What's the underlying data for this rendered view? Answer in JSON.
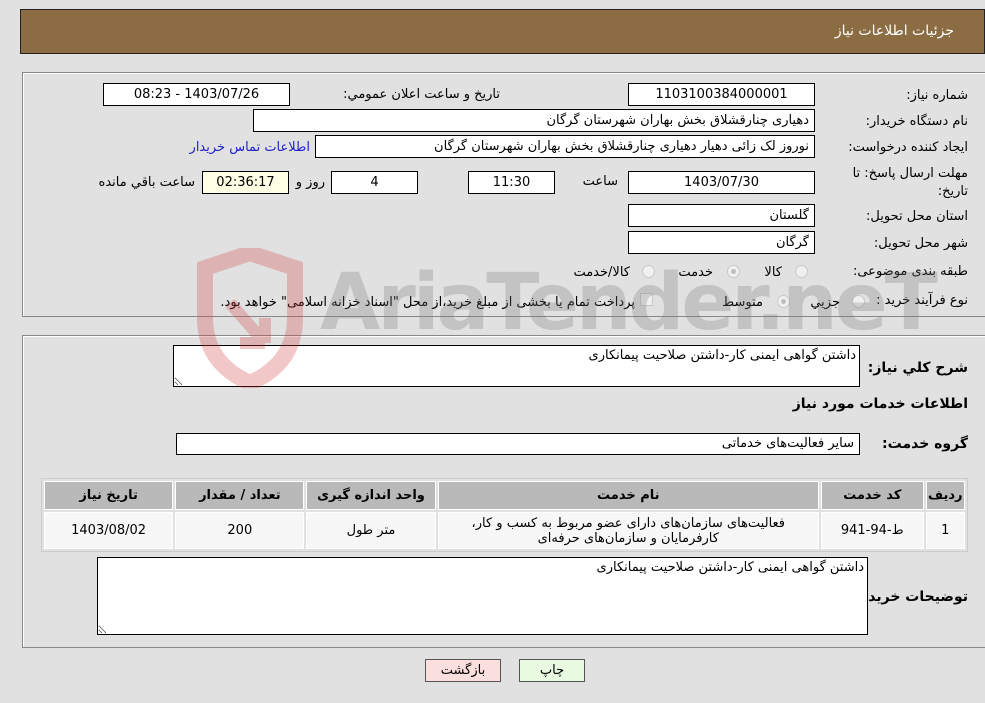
{
  "header": {
    "title": "جزئیات اطلاعات نیاز"
  },
  "form": {
    "need_number": {
      "label": "شماره نیاز:",
      "value": "1103100384000001"
    },
    "announce_datetime": {
      "label": "تاریخ و ساعت اعلان عمومي:",
      "value": "1403/07/26 - 08:23"
    },
    "buyer_org": {
      "label": "نام دستگاه خریدار:",
      "value": "دهیاری چنارقشلاق بخش بهاران شهرستان گرگان"
    },
    "requester": {
      "label": "ایجاد کننده درخواست:",
      "value": "نوروز لک زائی دهیار دهیاری چنارقشلاق بخش بهاران شهرستان گرگان"
    },
    "buyer_contact_link": "اطلاعات تماس خریدار",
    "deadline": {
      "label": "مهلت ارسال پاسخ: تا تاریخ:",
      "date": "1403/07/30",
      "time_label": "ساعت",
      "time": "11:30",
      "days": "4",
      "days_label": "روز و",
      "remaining": "02:36:17",
      "remaining_label": "ساعت باقي مانده"
    },
    "province": {
      "label": "استان محل تحویل:",
      "value": "گلستان"
    },
    "city": {
      "label": "شهر محل تحویل:",
      "value": "گرگان"
    },
    "category": {
      "label": "طبقه بندی موضوعی:",
      "options": [
        "کالا",
        "خدمت",
        "کالا/خدمت"
      ],
      "selected": "خدمت"
    },
    "purchase_type": {
      "label": "نوع فرآیند خرید :",
      "options": [
        "جزيي",
        "متوسط"
      ],
      "selected": "متوسط",
      "treasury_note": "پرداخت تمام یا بخشی از مبلغ خرید،از محل \"اسناد خزانه اسلامی\" خواهد بود.",
      "treasury_checked": false
    }
  },
  "details": {
    "summary_label": "شرح کلي نیاز:",
    "summary_value": "داشتن گواهی ایمنی کار-داشتن صلاحیت پیمانکاری",
    "services_heading": "اطلاعات خدمات مورد نیاز",
    "service_group_label": "گروه خدمت:",
    "service_group_value": "سایر فعالیت‌های خدماتی",
    "table": {
      "headers": [
        "ردیف",
        "کد خدمت",
        "نام خدمت",
        "واحد اندازه گیری",
        "تعداد / مقدار",
        "تاریخ نیاز"
      ],
      "rows": [
        {
          "row": "1",
          "code": "ط-94-941",
          "name": "فعالیت‌های سازمان‌های دارای عضو مربوط به کسب و کار، کارفرمایان و سازمان‌های حرفه‌ای",
          "unit": "متر طول",
          "qty": "200",
          "date": "1403/08/02"
        }
      ]
    },
    "buyer_notes_label": "توضیحات خریدار:",
    "buyer_notes_value": "داشتن گواهی ایمنی کار-داشتن صلاحیت پیمانکاری"
  },
  "buttons": {
    "print": "چاپ",
    "back": "بازگشت"
  },
  "watermark": {
    "text": "AriaTender.neT"
  }
}
